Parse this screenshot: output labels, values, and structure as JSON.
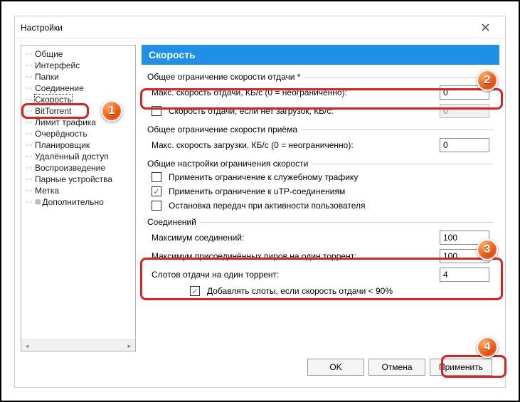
{
  "window": {
    "title": "Настройки"
  },
  "sidebar": {
    "items": [
      "Общие",
      "Интерфейс",
      "Папки",
      "Соединение",
      "Скорость",
      "BitTorrent",
      "Лимит трафика",
      "Очерёдность",
      "Планировщик",
      "Удалённый доступ",
      "Воспроизведение",
      "Парные устройства",
      "Метка",
      "Дополнительно"
    ],
    "selected_index": 4
  },
  "header": "Скорость",
  "groups": {
    "upload_limit": {
      "title": "Общее ограничение скорости отдачи *",
      "max_upload_label": "Макс. скорость отдачи, КБ/с (0 = неограниченно):",
      "max_upload_value": "0",
      "alt_upload_check": false,
      "alt_upload_label": "Скорость отдачи, если нет загрузок, КБ/с:",
      "alt_upload_value": "0"
    },
    "download_limit": {
      "title": "Общее ограничение скорости приёма",
      "max_download_label": "Макс. скорость загрузки, КБ/с (0 = неограниченно):",
      "max_download_value": "0"
    },
    "general": {
      "title": "Общие настройки ограничения скорости",
      "opt1_check": false,
      "opt1_label": "Применить ограничение к служебному трафику",
      "opt2_check": true,
      "opt2_label": "Применить ограничение к uTP-соединениям",
      "opt3_check": false,
      "opt3_label": "Остановка передач при активности пользователя"
    },
    "connections": {
      "title": "Соединений",
      "max_conn_label": "Максимум соединений:",
      "max_conn_value": "100",
      "max_peers_label": "Максимум присоединённых пиров на один торрент:",
      "max_peers_value": "100",
      "slots_label": "Слотов отдачи на один торрент:",
      "slots_value": "4",
      "add_slots_check": true,
      "add_slots_label": "Добавлять слоты, если скорость отдачи < 90%"
    }
  },
  "buttons": {
    "ok": "OK",
    "cancel": "Отмена",
    "apply": "Применить"
  },
  "badges": [
    "1",
    "2",
    "3",
    "4"
  ]
}
